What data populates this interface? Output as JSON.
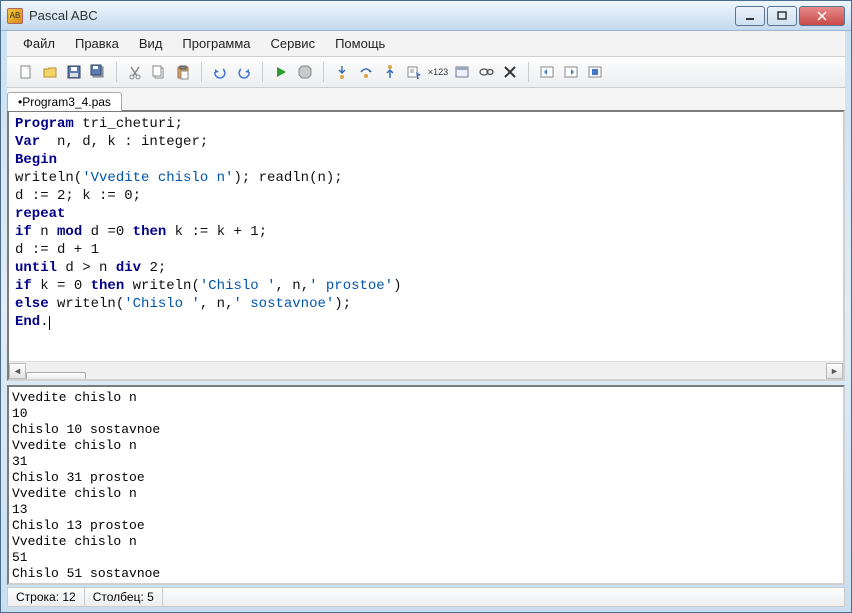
{
  "window": {
    "title": "Pascal ABC"
  },
  "menu": {
    "file": "Файл",
    "edit": "Правка",
    "view": "Вид",
    "program": "Программа",
    "service": "Сервис",
    "help": "Помощь"
  },
  "tabs": {
    "active": "•Program3_4.pas"
  },
  "code": {
    "l1a": "Program",
    "l1b": " tri_cheturi;",
    "l2a": "Var",
    "l2b": "  n, d, k : integer;",
    "l3": "Begin",
    "l4a": "writeln(",
    "l4b": "'Vvedite chislo n'",
    "l4c": "); readln(n);",
    "l5": "d := 2; k := 0;",
    "l6": "repeat",
    "l7a": "if",
    "l7b": " n ",
    "l7c": "mod",
    "l7d": " d =0 ",
    "l7e": "then",
    "l7f": " k := k + 1;",
    "l8": "d := d + 1",
    "l9a": "until",
    "l9b": " d > n ",
    "l9c": "div",
    "l9d": " 2;",
    "l10a": "if",
    "l10b": " k = 0 ",
    "l10c": "then",
    "l10d": " writeln(",
    "l10e": "'Chislo '",
    "l10f": ", n,",
    "l10g": "' prostoe'",
    "l10h": ")",
    "l11a": "else",
    "l11b": " writeln(",
    "l11c": "'Chislo '",
    "l11d": ", n,",
    "l11e": "' sostavnoe'",
    "l11f": ");",
    "l12a": "End",
    "l12b": "."
  },
  "output": "Vvedite chislo n\n10\nChislo 10 sostavnoe\nVvedite chislo n\n31\nChislo 31 prostoe\nVvedite chislo n\n13\nChislo 13 prostoe\nVvedite chislo n\n51\nChislo 51 sostavnoe",
  "status": {
    "line": "Строка: 12",
    "col": "Столбец: 5"
  }
}
